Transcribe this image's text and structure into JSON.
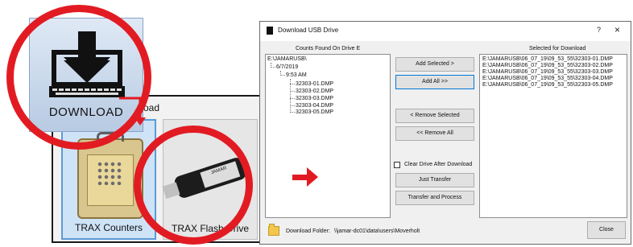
{
  "left_graphic": {
    "window_title_fragment": "oad",
    "download_tile_label": "DOWNLOAD",
    "tiles": [
      {
        "label": "TRAX Counters"
      },
      {
        "label": "TRAX Flash Drive"
      }
    ],
    "usb_label": "JAMAR"
  },
  "dialog": {
    "title": "Download USB Drive",
    "help": "?",
    "close_glyph": "×",
    "left_header": "Counts Found On Drive E",
    "right_header": "Selected  for Download",
    "tree": {
      "root": "E:\\JAMARUSB\\",
      "date": "6/7/2019",
      "time": "9:53 AM",
      "files": [
        "32303-01.DMP",
        "32303-02.DMP",
        "32303-03.DMP",
        "32303-04.DMP",
        "32303-05.DMP"
      ]
    },
    "selected_items": [
      "E:\\JAMARUSB\\06_07_19\\09_53_55\\32303-01.DMP",
      "E:\\JAMARUSB\\06_07_19\\09_53_55\\32303-02.DMP",
      "E:\\JAMARUSB\\06_07_19\\09_53_55\\32303-03.DMP",
      "E:\\JAMARUSB\\06_07_19\\09_53_55\\32303-04.DMP",
      "E:\\JAMARUSB\\06_07_19\\09_53_55\\32303-05.DMP"
    ],
    "buttons": {
      "add_selected": "Add Selected >",
      "add_all": "Add All >>",
      "remove_selected": "< Remove Selected",
      "remove_all": "<< Remove All",
      "just_transfer": "Just Transfer",
      "transfer_process": "Transfer and Process",
      "close": "Close"
    },
    "clear_drive_label": "Clear Drive After Download",
    "download_folder_label": "Download Folder:",
    "download_folder_path": "\\\\jamar-dc01\\data\\users\\Moverholt"
  },
  "colors": {
    "highlight_red": "#e21b23",
    "dialog_bg": "#f0f0f0",
    "default_button_border": "#0078d7"
  }
}
